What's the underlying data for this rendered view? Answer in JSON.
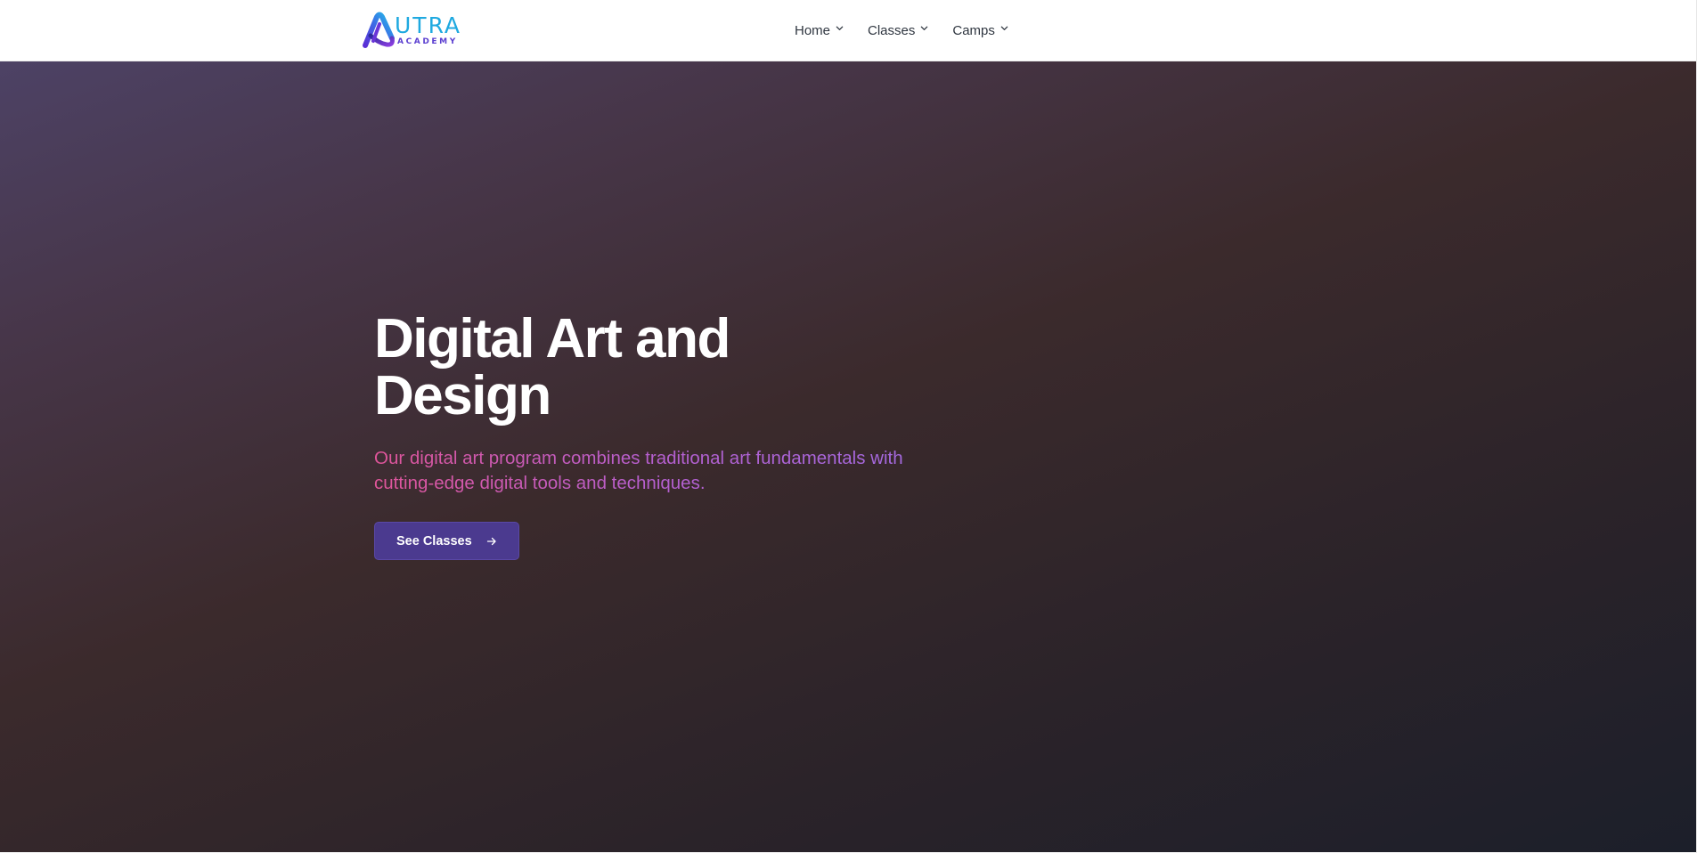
{
  "header": {
    "logo": {
      "main": "UTRA",
      "sub": "ACADEMY"
    },
    "nav": [
      {
        "label": "Home",
        "icon": "chevron-down-icon"
      },
      {
        "label": "Classes",
        "icon": "chevron-down-icon"
      },
      {
        "label": "Camps",
        "icon": "chevron-down-icon"
      }
    ]
  },
  "hero": {
    "title_line1": "Digital Art and",
    "title_line2": "Design",
    "description": "Our digital art program combines traditional art fundamentals with cutting-edge digital tools and techniques.",
    "cta_label": "See Classes",
    "cta_icon": "arrow-right-icon"
  },
  "colors": {
    "logo_text": "#1fa9e0",
    "logo_sub": "#5b3fd0",
    "cta_bg": "#4b3a8f",
    "hero_desc_start": "#e0559a",
    "hero_desc_end": "#a36ae0"
  }
}
